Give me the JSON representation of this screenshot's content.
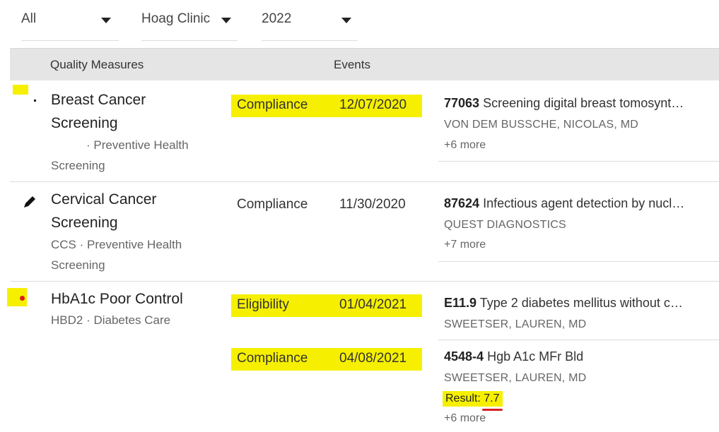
{
  "filters": [
    {
      "value": "All"
    },
    {
      "value": "Hoag Clinic"
    },
    {
      "value": "2022"
    }
  ],
  "table": {
    "headers": {
      "measures": "Quality Measures",
      "events": "Events"
    }
  },
  "measures": [
    {
      "name_line1": "Breast Cancer",
      "name_line2": "Screening",
      "sub_line1": "· Preventive Health",
      "sub_line2": "Screening",
      "events": [
        {
          "type": "Compliance",
          "date": "12/07/2020",
          "code": "77063",
          "description": "Screening digital breast tomosynt…",
          "provider": "VON DEM BUSSCHE, NICOLAS, MD",
          "more": "+6 more",
          "highlighted": true
        }
      ]
    },
    {
      "name_line1": "Cervical Cancer",
      "name_line2": "Screening",
      "sub_line1": "CCS · Preventive Health",
      "sub_line2": "Screening",
      "icon": "pencil-icon",
      "events": [
        {
          "type": "Compliance",
          "date": "11/30/2020",
          "code": "87624",
          "description": "Infectious agent detection by nucl…",
          "provider": "QUEST DIAGNOSTICS",
          "more": "+7 more",
          "highlighted": false
        }
      ]
    },
    {
      "name_line1": "HbA1c Poor Control",
      "sub_line1": "HBD2 · Diabetes Care",
      "icon": "red-dot-icon",
      "events": [
        {
          "type": "Eligibility",
          "date": "01/04/2021",
          "code": "E11.9",
          "description": "Type 2 diabetes mellitus without c…",
          "provider": "SWEETSER, LAUREN, MD",
          "highlighted": true
        },
        {
          "type": "Compliance",
          "date": "04/08/2021",
          "code": "4548-4",
          "description": "Hgb A1c MFr Bld",
          "provider": "SWEETSER, LAUREN, MD",
          "result_label": "Result: ",
          "result_value": "7.7",
          "more": "+6 more",
          "highlighted": true
        }
      ]
    }
  ],
  "colors": {
    "highlight": "#f6f000",
    "header_bg": "#e5e5e5",
    "red_mark": "#d62020"
  }
}
